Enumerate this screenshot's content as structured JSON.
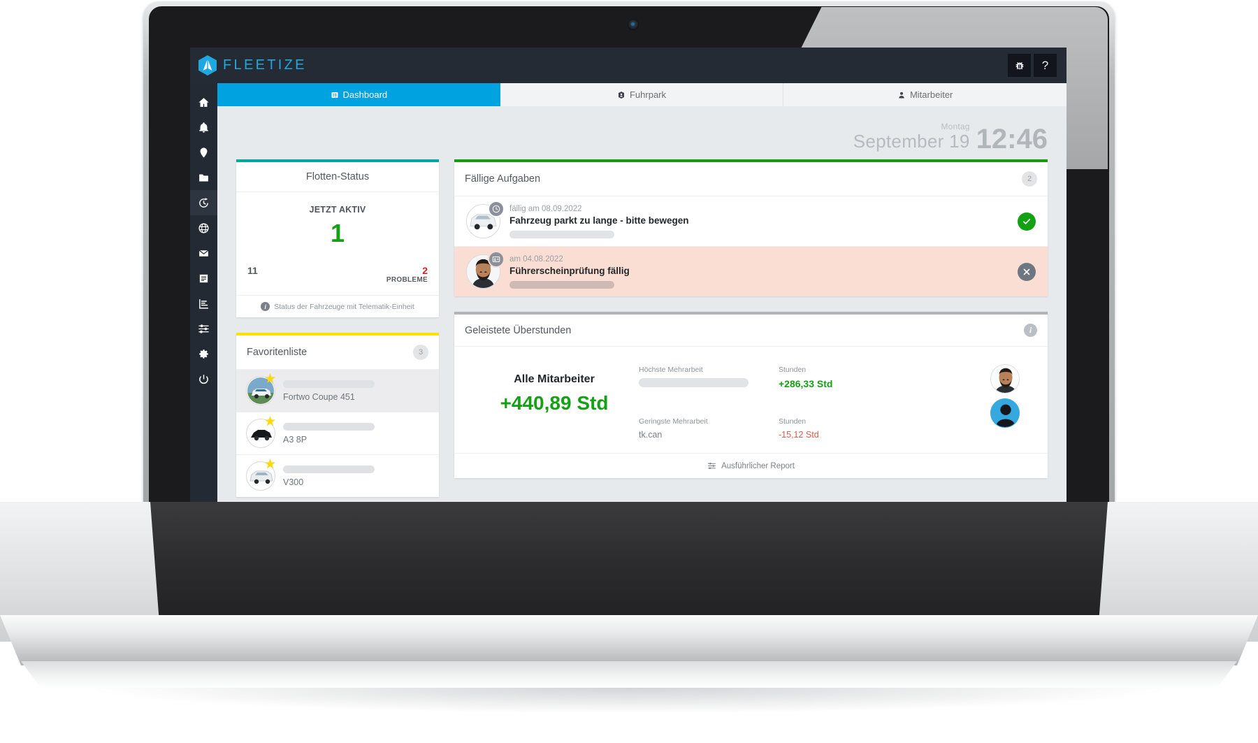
{
  "header": {
    "brand": "FLEETIZE",
    "logo_icon": "fleetize-logo-icon",
    "actions": [
      {
        "name": "bug-report-button",
        "icon": "bug-icon",
        "label": "🐞"
      },
      {
        "name": "help-button",
        "icon": "question-mark-icon",
        "label": "?"
      }
    ]
  },
  "sidebar": {
    "items": [
      {
        "name": "sidebar-item-home",
        "icon": "home-icon",
        "active": false
      },
      {
        "name": "sidebar-item-notifications",
        "icon": "bell-icon",
        "active": false
      },
      {
        "name": "sidebar-item-locations",
        "icon": "map-pin-icon",
        "active": false
      },
      {
        "name": "sidebar-item-files",
        "icon": "folder-icon",
        "active": false
      },
      {
        "name": "sidebar-item-timetracking",
        "icon": "timer-history-icon",
        "active": true
      },
      {
        "name": "sidebar-item-web",
        "icon": "globe-icon",
        "active": false
      },
      {
        "name": "sidebar-item-mail",
        "icon": "envelope-icon",
        "active": false
      },
      {
        "name": "sidebar-item-documents",
        "icon": "document-icon",
        "active": false
      },
      {
        "name": "sidebar-item-reports",
        "icon": "bar-chart-icon",
        "active": false
      },
      {
        "name": "sidebar-item-filters",
        "icon": "sliders-icon",
        "active": false
      },
      {
        "name": "sidebar-item-settings",
        "icon": "gear-icon",
        "active": false
      },
      {
        "name": "sidebar-item-logout",
        "icon": "power-icon",
        "active": false
      }
    ]
  },
  "tabs": [
    {
      "name": "tab-dashboard",
      "label": "Dashboard",
      "icon": "dashboard-grid-icon",
      "active": true
    },
    {
      "name": "tab-fuhrpark",
      "label": "Fuhrpark",
      "icon": "vehicle-box-icon",
      "active": false
    },
    {
      "name": "tab-mitarbeiter",
      "label": "Mitarbeiter",
      "icon": "person-icon",
      "active": false
    }
  ],
  "clock": {
    "weekday": "Montag",
    "date": "September 19",
    "time": "12:46"
  },
  "fleet_status": {
    "title": "Flotten-Status",
    "accent_color": "#00a89c",
    "active_label": "JETZT AKTIV",
    "active_value": "1",
    "total_value": "11",
    "problem_value": "2",
    "problem_label": "PROBLEME",
    "footnote": "Status der Fahrzeuge mit Telematik-Einheit"
  },
  "favorites": {
    "title": "Favoritenliste",
    "accent_color": "#ffe100",
    "count": "3",
    "items": [
      {
        "name": "Fortwo Coupe 451",
        "selected": true,
        "icon": "vehicle-thumbnail"
      },
      {
        "name": "A3 8P",
        "selected": false,
        "icon": "vehicle-thumbnail"
      },
      {
        "name": "V300",
        "selected": false,
        "icon": "vehicle-thumbnail"
      }
    ]
  },
  "tasks": {
    "title": "Fällige Aufgaben",
    "accent_color": "#159b0c",
    "count": "2",
    "items": [
      {
        "date": "fällig am 08.09.2022",
        "title": "Fahrzeug parkt zu lange - bitte bewegen",
        "badge_icon": "clock-icon",
        "action_icon": "check-icon",
        "action_type": "ok",
        "alert": false
      },
      {
        "date": "am 04.08.2022",
        "title": "Führerscheinprüfung fällig",
        "badge_icon": "id-card-icon",
        "action_icon": "close-icon",
        "action_type": "dismiss",
        "alert": true
      }
    ]
  },
  "overtime": {
    "title": "Geleistete Überstunden",
    "accent_color": "#b0b4b8",
    "info_icon": "info-icon",
    "all_employees_label": "Alle Mitarbeiter",
    "all_employees_value": "+440,89 Std",
    "highest_label": "Höchste Mehrarbeit",
    "highest_hours_label": "Stunden",
    "highest_hours_value": "+286,33 Std",
    "lowest_label": "Geringste Mehrarbeit",
    "lowest_name": "tk.can",
    "lowest_hours_label": "Stunden",
    "lowest_hours_value": "-15,12 Std",
    "report_link": "Ausführlicher Report",
    "report_icon": "sliders-icon"
  }
}
